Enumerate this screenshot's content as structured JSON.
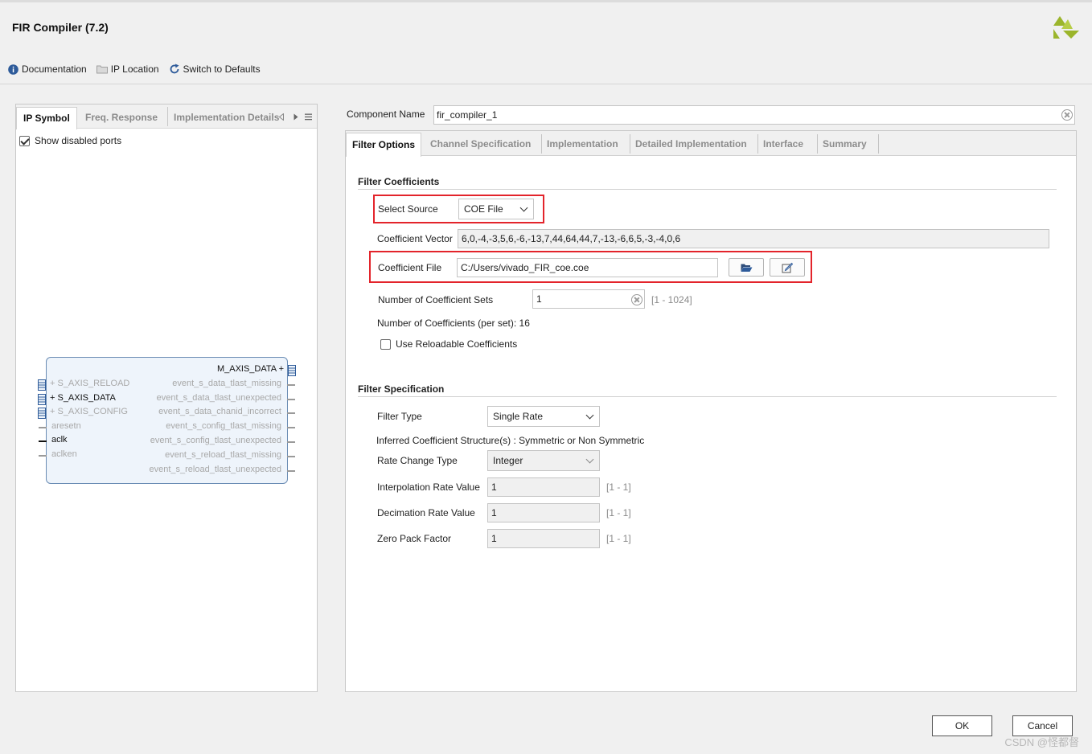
{
  "window": {
    "title": "FIR Compiler (7.2)"
  },
  "toolbar": {
    "documentation": "Documentation",
    "ip_location": "IP Location",
    "switch_defaults": "Switch to Defaults"
  },
  "left_panel": {
    "tabs": [
      "IP Symbol",
      "Freq. Response",
      "Implementation Details"
    ],
    "show_disabled_ports": "Show disabled ports",
    "symbol": {
      "left_ports": [
        {
          "name": "S_AXIS_RELOAD",
          "enabled": false,
          "bus": true
        },
        {
          "name": "S_AXIS_DATA",
          "enabled": true,
          "bus": true
        },
        {
          "name": "S_AXIS_CONFIG",
          "enabled": false,
          "bus": true
        },
        {
          "name": "aresetn",
          "enabled": false,
          "bus": false
        },
        {
          "name": "aclk",
          "enabled": true,
          "bus": false
        },
        {
          "name": "aclken",
          "enabled": false,
          "bus": false
        }
      ],
      "right_ports": [
        {
          "name": "M_AXIS_DATA",
          "enabled": true,
          "bus": true
        },
        {
          "name": "event_s_data_tlast_missing",
          "enabled": false
        },
        {
          "name": "event_s_data_tlast_unexpected",
          "enabled": false
        },
        {
          "name": "event_s_data_chanid_incorrect",
          "enabled": false
        },
        {
          "name": "event_s_config_tlast_missing",
          "enabled": false
        },
        {
          "name": "event_s_config_tlast_unexpected",
          "enabled": false
        },
        {
          "name": "event_s_reload_tlast_missing",
          "enabled": false
        },
        {
          "name": "event_s_reload_tlast_unexpected",
          "enabled": false
        }
      ]
    }
  },
  "component": {
    "label": "Component Name",
    "value": "fir_compiler_1"
  },
  "right_tabs": [
    "Filter Options",
    "Channel Specification",
    "Implementation",
    "Detailed Implementation",
    "Interface",
    "Summary"
  ],
  "filter_coefficients": {
    "heading": "Filter Coefficients",
    "select_source_label": "Select Source",
    "select_source_value": "COE File",
    "coeff_vector_label": "Coefficient Vector",
    "coeff_vector_value": "6,0,-4,-3,5,6,-6,-13,7,44,64,44,7,-13,-6,6,5,-3,-4,0,6",
    "coeff_file_label": "Coefficient File",
    "coeff_file_value": "C:/Users/vivado_FIR_coe.coe",
    "num_sets_label": "Number of Coefficient Sets",
    "num_sets_value": "1",
    "num_sets_range": "[1 - 1024]",
    "num_coeffs_label": "Number of Coefficients (per set): 16",
    "reloadable_label": "Use Reloadable Coefficients"
  },
  "filter_specification": {
    "heading": "Filter Specification",
    "filter_type_label": "Filter Type",
    "filter_type_value": "Single Rate",
    "inferred_label": "Inferred Coefficient Structure(s) : Symmetric or Non Symmetric",
    "rate_change_label": "Rate Change Type",
    "rate_change_value": "Integer",
    "interp_label": "Interpolation Rate Value",
    "interp_value": "1",
    "interp_range": "[1 - 1]",
    "decim_label": "Decimation Rate Value",
    "decim_value": "1",
    "decim_range": "[1 - 1]",
    "zero_pack_label": "Zero Pack Factor",
    "zero_pack_value": "1",
    "zero_pack_range": "[1 - 1]"
  },
  "buttons": {
    "ok": "OK",
    "cancel": "Cancel"
  },
  "watermark": "CSDN @怪都督"
}
